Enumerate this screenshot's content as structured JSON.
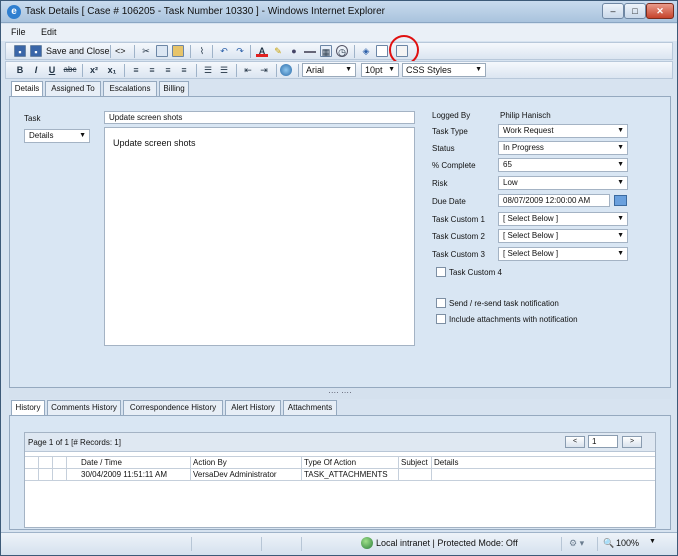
{
  "window": {
    "title": "Task Details [ Case # 106205 - Task Number 10330 ] - Windows Internet Explorer",
    "minimize_glyph": "–",
    "maximize_glyph": "□",
    "close_glyph": "✕"
  },
  "menubar": {
    "items": [
      "File",
      "Edit"
    ]
  },
  "toolbar1": {
    "save_close_label": "Save and Close",
    "source_label": "<>"
  },
  "toolbar2": {
    "bold": "B",
    "italic": "I",
    "underline": "U",
    "strike": "abc",
    "superscript": "x²",
    "subscript": "x₁",
    "font_family": "Arial",
    "font_size": "10pt",
    "css_styles": "CSS Styles"
  },
  "tabs": [
    "Details",
    "Assigned To",
    "Escalations",
    "Billing"
  ],
  "details": {
    "task_label": "Task",
    "task_value": "Update screen shots",
    "field_select": "Details",
    "description": "Update screen shots",
    "logged_by_label": "Logged By",
    "logged_by_value": "Philip Hanisch",
    "task_type_label": "Task Type",
    "task_type_value": "Work Request",
    "status_label": "Status",
    "status_value": "In Progress",
    "complete_label": "% Complete",
    "complete_value": "65",
    "risk_label": "Risk",
    "risk_value": "Low",
    "due_date_label": "Due Date",
    "due_date_value": "08/07/2009 12:00:00 AM",
    "custom1_label": "Task Custom 1",
    "custom1_value": "[ Select Below ]",
    "custom2_label": "Task Custom 2",
    "custom2_value": "[ Select Below ]",
    "custom3_label": "Task Custom 3",
    "custom3_value": "[ Select Below ]",
    "custom4_label": "Task Custom 4",
    "notify_label": "Send / re-send task notification",
    "attach_label": "Include attachments with notification"
  },
  "splitter": "····  ····",
  "history_tabs": [
    "History",
    "Comments History",
    "Correspondence History",
    "Alert History",
    "Attachments"
  ],
  "history": {
    "pager_text": "Page 1 of 1 [# Records: 1]",
    "page_input": "1",
    "prev": "<",
    "next": ">",
    "columns": [
      "Date / Time",
      "Action By",
      "Type Of Action",
      "Subject",
      "Details"
    ],
    "rows": [
      [
        "30/04/2009 11:51:11 AM",
        "VersaDev  Administrator",
        "TASK_ATTACHMENTS",
        "",
        ""
      ]
    ]
  },
  "statusbar": {
    "zone": "Local intranet | Protected Mode: Off",
    "zoom": "100%"
  }
}
